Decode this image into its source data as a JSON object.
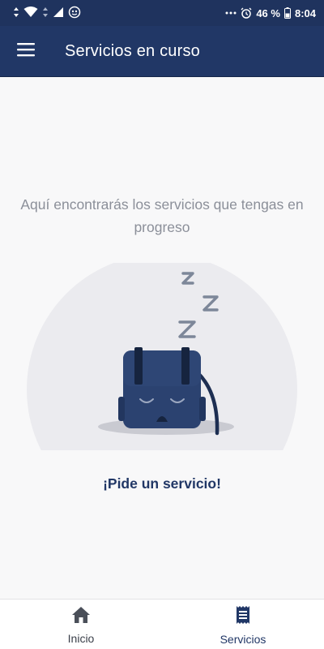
{
  "status_bar": {
    "battery": "46 %",
    "time": "8:04",
    "icons": [
      "wifi-icon",
      "signal-icon",
      "app-notification-icon",
      "more-icon",
      "alarm-icon",
      "battery-icon"
    ]
  },
  "app_bar": {
    "title": "Servicios en curso",
    "menu_icon": "hamburger-menu-icon"
  },
  "empty_state": {
    "message": "Aquí encontrarás los servicios que tengas en progreso",
    "illustration": "sleeping-backpack-illustration",
    "cta": "¡Pide un servicio!"
  },
  "bottom_nav": {
    "items": [
      {
        "label": "Inicio",
        "icon": "home-icon",
        "active": false
      },
      {
        "label": "Servicios",
        "icon": "receipt-icon",
        "active": true
      }
    ]
  },
  "colors": {
    "primary": "#213766",
    "background": "#f8f8f9",
    "text_muted": "#8b8f99",
    "backpack": "#2b4270"
  }
}
